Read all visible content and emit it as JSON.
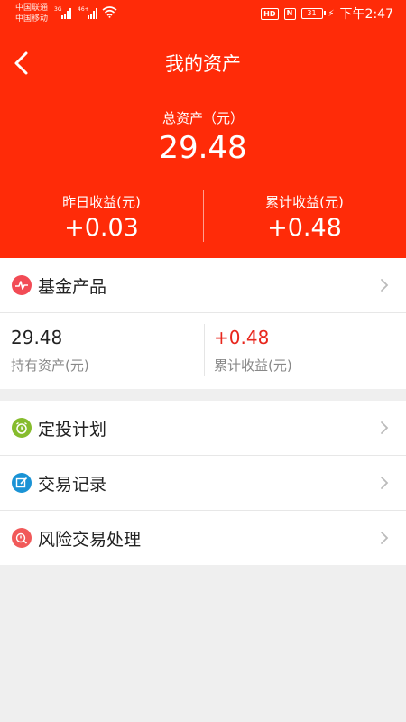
{
  "status_bar": {
    "carrier1": "中国联通",
    "carrier2": "中国移动",
    "net1": "3G",
    "net2": "46+",
    "hd": "HD",
    "nfc": "N",
    "battery": "31",
    "time": "下午2:47"
  },
  "header": {
    "title": "我的资产",
    "back_icon": "chevron-left-icon",
    "total_label": "总资产（元）",
    "total_value": "29.48",
    "yesterday_label": "昨日收益(元)",
    "yesterday_value": "+0.03",
    "cumulative_label": "累计收益(元)",
    "cumulative_value": "+0.48"
  },
  "fund": {
    "title": "基金产品",
    "icon": "pulse-icon",
    "icon_color": "#f24b55",
    "holding_value": "29.48",
    "holding_label": "持有资产(元)",
    "cumulative_value": "+0.48",
    "cumulative_label": "累计收益(元)"
  },
  "menu": [
    {
      "label": "定投计划",
      "icon": "alarm-clock-icon",
      "color": "#86bc2d"
    },
    {
      "label": "交易记录",
      "icon": "edit-icon",
      "color": "#1a93d5"
    },
    {
      "label": "风险交易处理",
      "icon": "risk-icon",
      "color": "#f15a5a"
    }
  ],
  "colors": {
    "brand": "#ff2b08",
    "positive": "#e8261c"
  }
}
